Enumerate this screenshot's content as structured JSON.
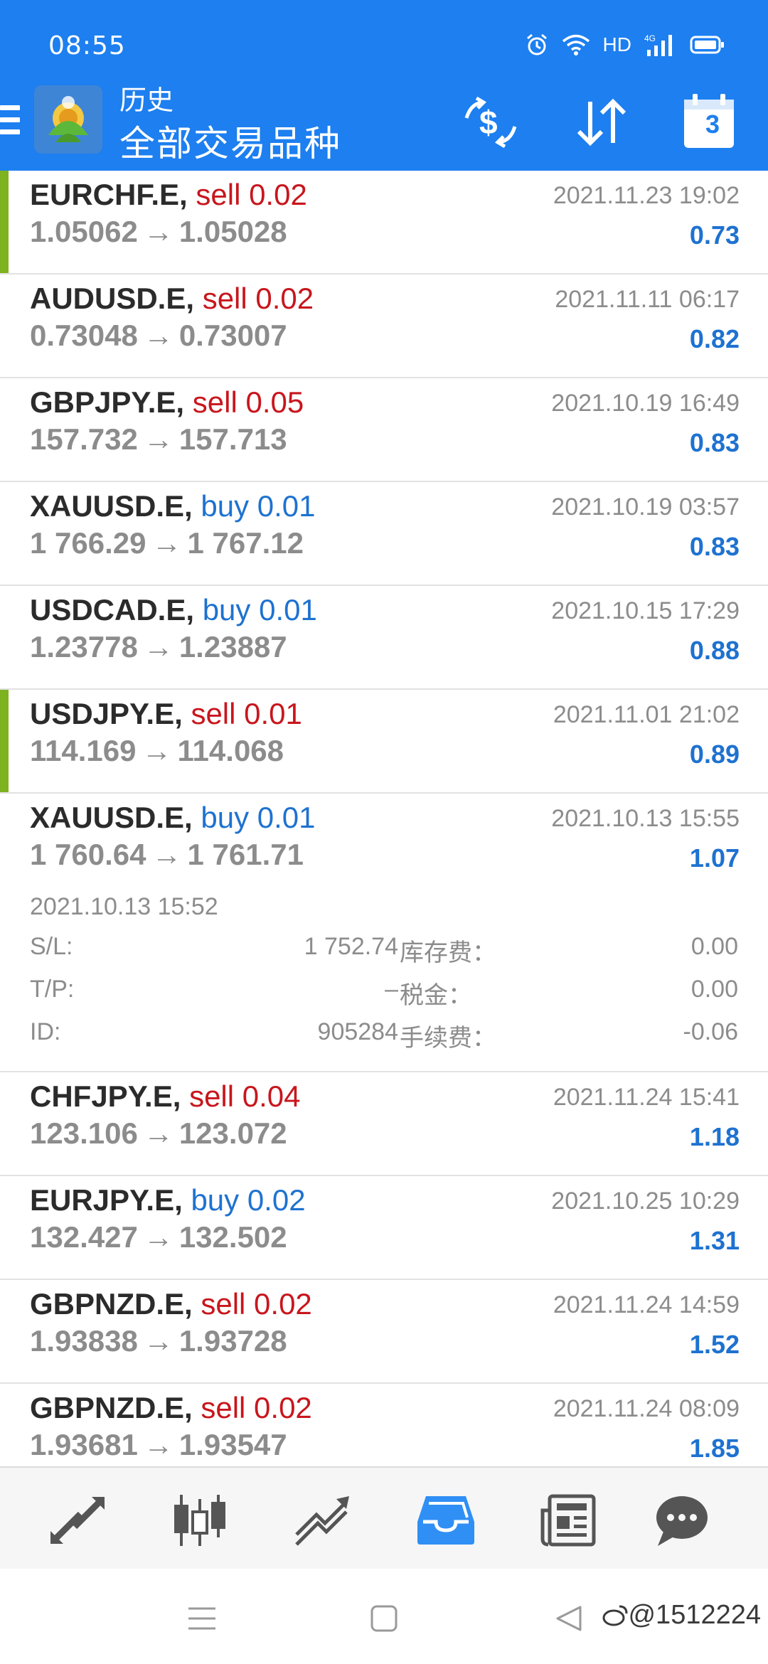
{
  "status_bar": {
    "time": "08:55",
    "network_label": "HD",
    "signal_label": "4G"
  },
  "header": {
    "title_small": "历史",
    "title_large": "全部交易品种",
    "calendar_day": "3",
    "bg_color": "#1d7ff0"
  },
  "trades": [
    {
      "symbol": "EURCHF.E,",
      "side": "sell",
      "volume": "sell 0.02",
      "open_price": "1.05062",
      "close_price": "1.05028",
      "time": "2021.11.23 19:02",
      "profit": "0.73",
      "marked": true
    },
    {
      "symbol": "AUDUSD.E,",
      "side": "sell",
      "volume": "sell 0.02",
      "open_price": "0.73048",
      "close_price": "0.73007",
      "time": "2021.11.11 06:17",
      "profit": "0.82",
      "marked": false
    },
    {
      "symbol": "GBPJPY.E,",
      "side": "sell",
      "volume": "sell 0.05",
      "open_price": "157.732",
      "close_price": "157.713",
      "time": "2021.10.19 16:49",
      "profit": "0.83",
      "marked": false
    },
    {
      "symbol": "XAUUSD.E,",
      "side": "buy",
      "volume": "buy 0.01",
      "open_price": "1 766.29",
      "close_price": "1 767.12",
      "time": "2021.10.19 03:57",
      "profit": "0.83",
      "marked": false
    },
    {
      "symbol": "USDCAD.E,",
      "side": "buy",
      "volume": "buy 0.01",
      "open_price": "1.23778",
      "close_price": "1.23887",
      "time": "2021.10.15 17:29",
      "profit": "0.88",
      "marked": false
    },
    {
      "symbol": "USDJPY.E,",
      "side": "sell",
      "volume": "sell 0.01",
      "open_price": "114.169",
      "close_price": "114.068",
      "time": "2021.11.01 21:02",
      "profit": "0.89",
      "marked": true
    },
    {
      "symbol": "XAUUSD.E,",
      "side": "buy",
      "volume": "buy 0.01",
      "open_price": "1 760.64",
      "close_price": "1 761.71",
      "time": "2021.10.13 15:55",
      "profit": "1.07",
      "marked": false,
      "expanded": {
        "open_time": "2021.10.13 15:52",
        "sl_label": "S/L:",
        "sl_value": "1 752.74",
        "tp_label": "T/P:",
        "tp_value": "–",
        "id_label": "ID:",
        "id_value": "905284",
        "swap_label": "库存费：",
        "swap_value": "0.00",
        "tax_label": "税金：",
        "tax_value": "0.00",
        "commission_label": "手续费：",
        "commission_value": "-0.06"
      }
    },
    {
      "symbol": "CHFJPY.E,",
      "side": "sell",
      "volume": "sell 0.04",
      "open_price": "123.106",
      "close_price": "123.072",
      "time": "2021.11.24 15:41",
      "profit": "1.18",
      "marked": false
    },
    {
      "symbol": "EURJPY.E,",
      "side": "buy",
      "volume": "buy 0.02",
      "open_price": "132.427",
      "close_price": "132.502",
      "time": "2021.10.25 10:29",
      "profit": "1.31",
      "marked": false
    },
    {
      "symbol": "GBPNZD.E,",
      "side": "sell",
      "volume": "sell 0.02",
      "open_price": "1.93838",
      "close_price": "1.93728",
      "time": "2021.11.24 14:59",
      "profit": "1.52",
      "marked": false
    },
    {
      "symbol": "GBPNZD.E,",
      "side": "sell",
      "volume": "sell 0.02",
      "open_price": "1.93681",
      "close_price": "1.93547",
      "time": "2021.11.24 08:09",
      "profit": "1.85",
      "marked": false
    }
  ],
  "arrow_glyph": "→",
  "tabs": [
    {
      "name": "quotes-icon",
      "active": false
    },
    {
      "name": "chart-icon",
      "active": false
    },
    {
      "name": "trade-icon",
      "active": false
    },
    {
      "name": "history-icon",
      "active": true
    },
    {
      "name": "news-icon",
      "active": false
    },
    {
      "name": "chat-icon",
      "active": false
    }
  ],
  "watermark": "@1512224",
  "colors": {
    "sell": "#c8161d",
    "buy": "#1e72d0",
    "profit": "#1e72d0",
    "marker": "#7fb21f",
    "tab_active": "#2f8ff5",
    "tab_inactive": "#555555"
  }
}
